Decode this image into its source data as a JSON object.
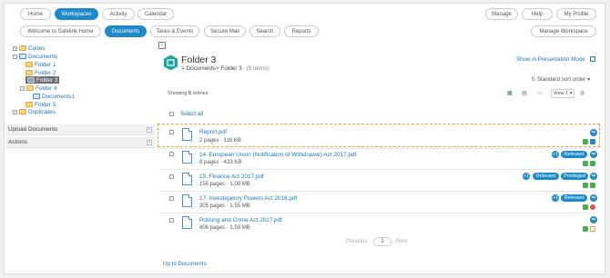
{
  "nav_top": {
    "home": "Home",
    "workspaces": "Workspaces",
    "activity": "Activity",
    "calendar": "Calendar",
    "manage": "Manage",
    "help": "Help",
    "my_profile": "My Profile"
  },
  "nav_sub": {
    "welcome": "Welcome to Safelink Home",
    "documents": "Documents",
    "tasks_events": "Tasks & Events",
    "secure_mail": "Secure Mail",
    "search": "Search",
    "reports": "Reports",
    "manage_workspace": "Manage Workspace"
  },
  "tree": {
    "codes": "Codes",
    "documents": "Documents",
    "folder1": "Folder 1",
    "folder2": "Folder 2",
    "folder3": "Folder 3",
    "folder4": "Folder 4",
    "documents1": "Documents1",
    "folder5": "Folder 5",
    "duplicates": "Duplicates"
  },
  "sidebar_sections": {
    "upload": "Upload Documents",
    "actions": "Actions"
  },
  "header": {
    "title": "Folder 3",
    "breadcrumb_prefix": ">",
    "breadcrumb_parent": "Documents",
    "breadcrumb_sep": ">",
    "breadcrumb_current": "Folder 3",
    "item_count": "(5 items)",
    "presentation_mode": "Show in Presentation Mode",
    "sort": "Standard sort order"
  },
  "toolbar": {
    "showing_prefix": "Showing",
    "showing_count": "5",
    "showing_suffix": "entries",
    "view": "View 1 ▾"
  },
  "list": {
    "select_all": "Select all",
    "files": [
      {
        "name": "Report.pdf",
        "meta": "2 pages · 116 KB"
      },
      {
        "name": "14. European Union (Notification of Withdrawal) Act 2017.pdf",
        "meta": "8 pages · 433 KB",
        "count": "+1",
        "tag1": "Relevant"
      },
      {
        "name": "15. Finance Act 2017.pdf",
        "meta": "155 pages · 1.08 MB",
        "count": "+1",
        "tag1": "Relevant",
        "tag2": "Privileged"
      },
      {
        "name": "17. Investigatory Powers Act 2016.pdf",
        "meta": "305 pages · 1.55 MB",
        "count": "+1",
        "tag1": "Relevant"
      },
      {
        "name": "Policing and Crime Act 2017.pdf",
        "meta": "406 pages · 1.59 MB"
      }
    ]
  },
  "pagination": {
    "previous": "Previous",
    "page": "1",
    "next": "Next"
  },
  "footer": {
    "up": "Up to Documents"
  },
  "colors": {
    "accent": "#1f8ac9",
    "selected_outline": "#f0a030",
    "green": "#4caf50",
    "orange": "#f0a030",
    "red": "#d9534f"
  }
}
